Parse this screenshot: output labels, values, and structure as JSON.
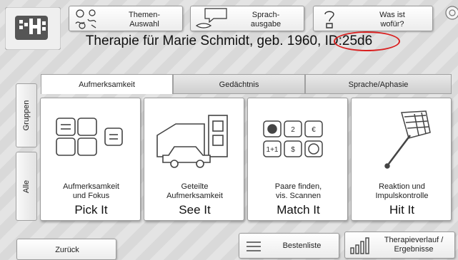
{
  "toolbar": {
    "topics_label": "Themen-\nAuswahl",
    "speech_label": "Sprach-\nausgabe",
    "help_label": "Was ist\nwofür?"
  },
  "header": {
    "title": "Therapie für Marie Schmidt, geb. 1960, ID:25d6"
  },
  "tabs": [
    {
      "label": "Aufmerksamkeit",
      "active": true
    },
    {
      "label": "Gedächtnis",
      "active": false
    },
    {
      "label": "Sprache/Aphasie",
      "active": false
    }
  ],
  "side_tabs": {
    "groups": "Gruppen",
    "all": "Alle"
  },
  "cards": [
    {
      "sub": "Aufmerksamkeit\nund Fokus",
      "name": "Pick It",
      "icon": "shapes-icon"
    },
    {
      "sub": "Geteilte\nAufmerksamkeit",
      "name": "See It",
      "icon": "car-garage-icon"
    },
    {
      "sub": "Paare finden,\nvis. Scannen",
      "name": "Match It",
      "icon": "tiles-icon"
    },
    {
      "sub": "Reaktion und\nImpulskontrolle",
      "name": "Hit It",
      "icon": "flyswatter-icon"
    }
  ],
  "match_tiles": [
    "2",
    "€",
    "1+1",
    "$"
  ],
  "bottom": {
    "back_label": "Zurück",
    "leaderboard_label": "Bestenliste",
    "progress_label": "Therapieverlauf /\nErgebnisse"
  },
  "colors": {
    "highlight": "#d92020",
    "logo_bg": "#555555"
  }
}
